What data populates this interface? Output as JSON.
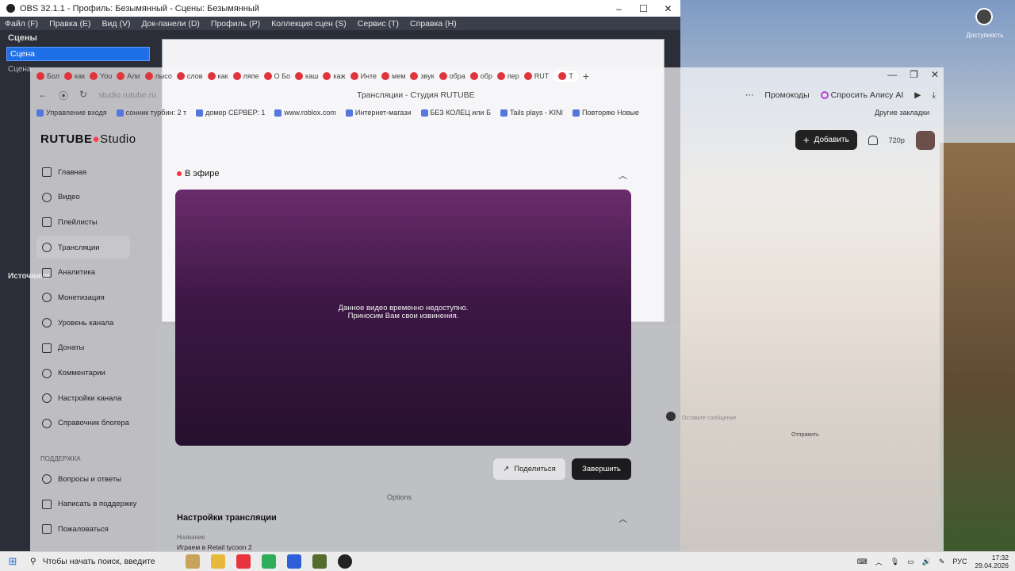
{
  "obs": {
    "title": "OBS 32.1.1 - Профиль: Безымянный - Сцены: Безымянный",
    "menu": [
      "Файл (F)",
      "Правка (E)",
      "Вид (V)",
      "Док-панели (D)",
      "Профиль (P)",
      "Коллекция сцен (S)",
      "Сервис (T)",
      "Справка (H)"
    ],
    "scenes_title": "Сцены",
    "scene_selected": "Сцена",
    "scene_other": "Сцена",
    "sources_title": "Источники",
    "options_label": "Options"
  },
  "browser": {
    "tabs": [
      "Бол",
      "как",
      "You",
      "Али",
      "лысо",
      "слов",
      "как",
      "ляпе",
      "О Бо",
      "каш",
      "каж",
      "Инте",
      "мем",
      "звук",
      "обра",
      "обр",
      "пер",
      "RUT",
      "Т"
    ],
    "active_tab": "Т",
    "url": "studio.rutube.ru",
    "page_title": "Трансляции - Студия RUTUBE",
    "promo_label": "Промокоды",
    "alisa_label": "Спросить Алису AI",
    "bookmarks": [
      "Управление входя",
      "сонник турбин: 2 т",
      "домер СЕРВЕР: 1",
      "www.roblox.com",
      "Интернет-магази",
      "БЕЗ КОЛЕЦ или Б",
      "Tails plays - KINI",
      "Повторяю Новые"
    ],
    "other_bookmarks": "Другие закладки"
  },
  "rutube": {
    "logo_main": "RUTUBE",
    "logo_studio": "Studio",
    "nav": [
      "Главная",
      "Видео",
      "Плейлисты",
      "Трансляции",
      "Аналитика",
      "Монетизация",
      "Уровень канала",
      "Донаты",
      "Комментарии",
      "Настройки канала",
      "Справочник блогера"
    ],
    "active_nav": "Трансляции",
    "support_title": "ПОДДЕРЖКА",
    "support": [
      "Вопросы и ответы",
      "Написать в поддержку",
      "Пожаловаться"
    ],
    "add_button": "Добавить",
    "quality": "720р",
    "live_label": "В эфире",
    "player_message_1": "Данное видео временно недоступно.",
    "player_message_2": "Приносим Вам свои извинения.",
    "share_button": "Поделиться",
    "end_button": "Завершить",
    "settings_title": "Настройки трансляции",
    "name_label": "Название",
    "name_value": "Играем в Retail tycoon 2",
    "chat_placeholder": "Оставьте сообщение",
    "chat_send": "Отправить"
  },
  "taskbar": {
    "search_placeholder": "Чтобы начать поиск, введите",
    "lang": "РУС",
    "time": "17:32",
    "date": "29.04.2026"
  },
  "desktop": {
    "sys_label": "Доступность"
  }
}
